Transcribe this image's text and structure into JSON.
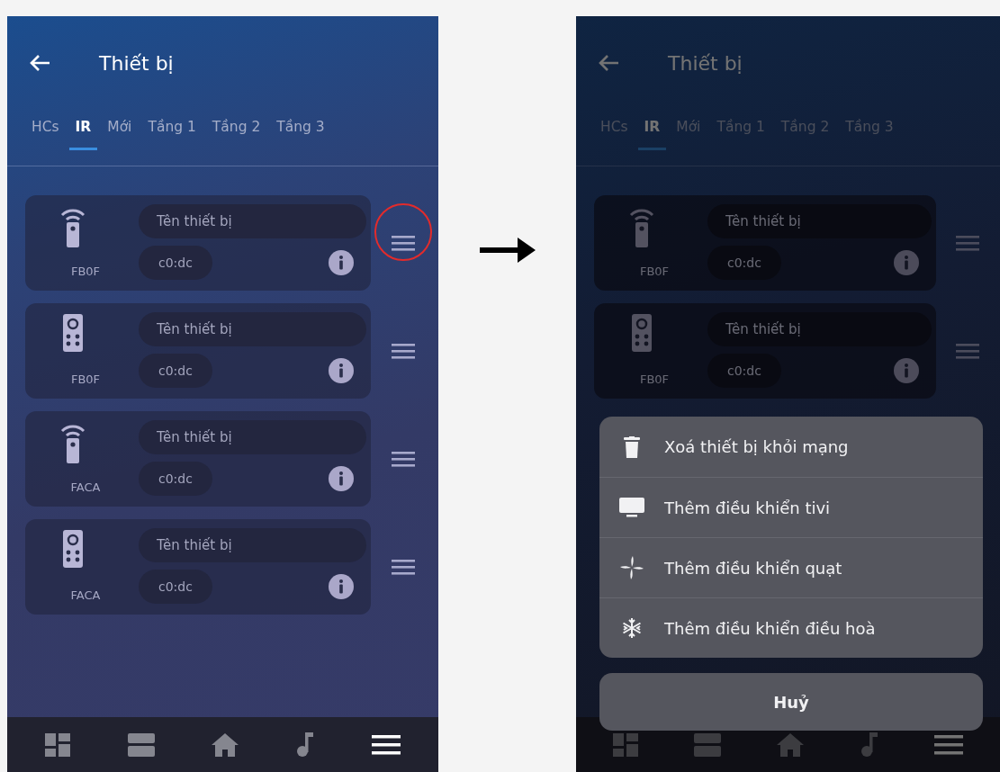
{
  "screens": [
    {
      "title": "Thiết bị",
      "dimmed": false,
      "tabs": [
        {
          "label": "HCs",
          "selected": false
        },
        {
          "label": "IR",
          "selected": true
        },
        {
          "label": "Mới",
          "selected": false
        },
        {
          "label": "Tầng 1",
          "selected": false
        },
        {
          "label": "Tầng 2",
          "selected": false
        },
        {
          "label": "Tầng 3",
          "selected": false
        }
      ],
      "devices": [
        {
          "kind": "wifi-remote",
          "code": "FB0F",
          "name_placeholder": "Tên thiết bị",
          "mac": "c0:dc",
          "highlighted": true
        },
        {
          "kind": "keypad-remote",
          "code": "FB0F",
          "name_placeholder": "Tên thiết bị",
          "mac": "c0:dc",
          "highlighted": false
        },
        {
          "kind": "wifi-remote",
          "code": "FACA",
          "name_placeholder": "Tên thiết bị",
          "mac": "c0:dc",
          "highlighted": false
        },
        {
          "kind": "keypad-remote",
          "code": "FACA",
          "name_placeholder": "Tên thiết bị",
          "mac": "c0:dc",
          "highlighted": false
        }
      ],
      "nav": [
        {
          "kind": "dashboard",
          "selected": false
        },
        {
          "kind": "rooms",
          "selected": false
        },
        {
          "kind": "home",
          "selected": false
        },
        {
          "kind": "music",
          "selected": false
        },
        {
          "kind": "menu",
          "selected": true
        }
      ]
    },
    {
      "title": "Thiết bị",
      "dimmed": true,
      "tabs": [
        {
          "label": "HCs",
          "selected": false
        },
        {
          "label": "IR",
          "selected": true
        },
        {
          "label": "Mới",
          "selected": false
        },
        {
          "label": "Tầng 1",
          "selected": false
        },
        {
          "label": "Tầng 2",
          "selected": false
        },
        {
          "label": "Tầng 3",
          "selected": false
        }
      ],
      "devices": [
        {
          "kind": "wifi-remote",
          "code": "FB0F",
          "name_placeholder": "Tên thiết bị",
          "mac": "c0:dc",
          "highlighted": false
        },
        {
          "kind": "keypad-remote",
          "code": "FB0F",
          "name_placeholder": "Tên thiết bị",
          "mac": "c0:dc",
          "highlighted": false
        }
      ],
      "nav": [
        {
          "kind": "dashboard",
          "selected": false
        },
        {
          "kind": "rooms",
          "selected": false
        },
        {
          "kind": "home",
          "selected": false
        },
        {
          "kind": "music",
          "selected": false
        },
        {
          "kind": "menu",
          "selected": true
        }
      ],
      "action_sheet": {
        "items": [
          {
            "kind": "delete",
            "label": "Xoá thiết bị khỏi mạng"
          },
          {
            "kind": "tv",
            "label": "Thêm điều khiển tivi"
          },
          {
            "kind": "fan",
            "label": "Thêm điều khiển quạt"
          },
          {
            "kind": "ac",
            "label": "Thêm điều khiển điều hoà"
          }
        ],
        "cancel": "Huỷ"
      }
    }
  ]
}
